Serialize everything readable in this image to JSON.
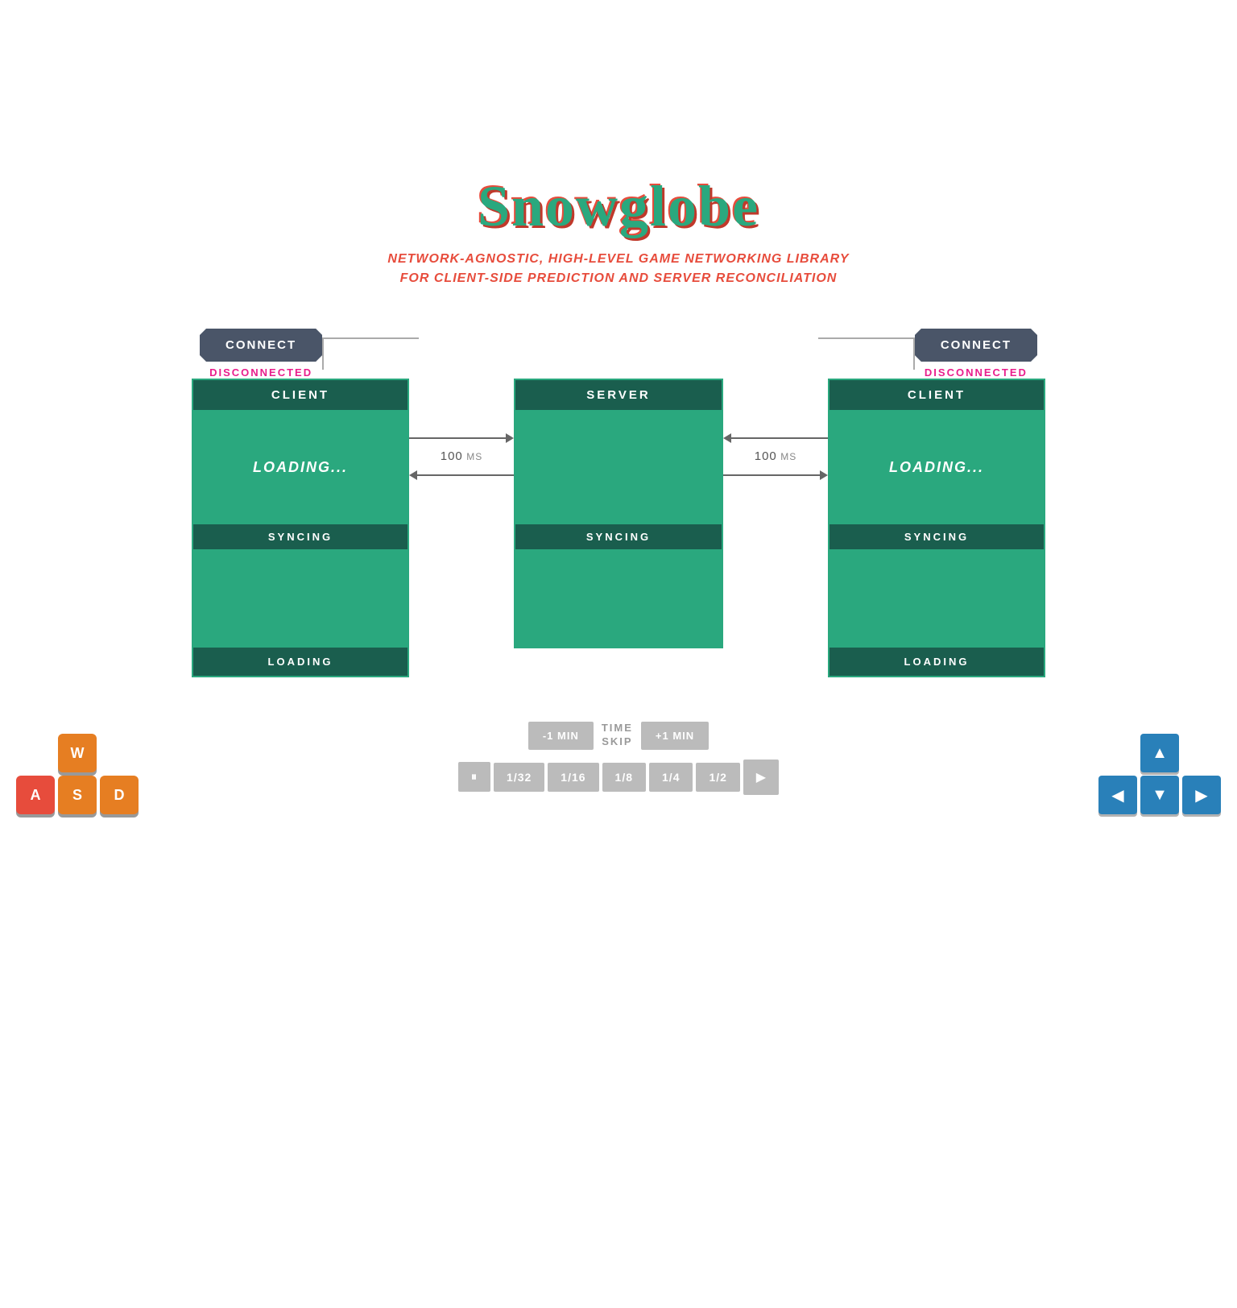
{
  "title": {
    "main": "Snowglobe",
    "subtitle_line1": "NETWORK-AGNOSTIC, HIGH-LEVEL GAME NETWORKING LIBRARY",
    "subtitle_line2": "FOR CLIENT-SIDE PREDICTION AND SERVER RECONCILIATION"
  },
  "left_connection": {
    "button_label": "CONNECT",
    "status": "DISCONNECTED"
  },
  "right_connection": {
    "button_label": "CONNECT",
    "status": "DISCONNECTED"
  },
  "left_client": {
    "header": "CLIENT",
    "loading": "LOADING...",
    "sync": "SYNCING",
    "footer": "LOADING"
  },
  "server": {
    "header": "SERVER",
    "sync": "SYNCING"
  },
  "right_client": {
    "header": "CLIENT",
    "loading": "LOADING...",
    "sync": "SYNCING",
    "footer": "LOADING"
  },
  "network_left": {
    "ms_value": "100",
    "ms_unit": "MS"
  },
  "network_right": {
    "ms_value": "100",
    "ms_unit": "MS"
  },
  "time_skip": {
    "label": "TIME\nSKIP",
    "minus_label": "-1 MIN",
    "plus_label": "+1 MIN"
  },
  "playback": {
    "pause_icon": "⏸",
    "speed_1": "1/32",
    "speed_2": "1/16",
    "speed_3": "1/8",
    "speed_4": "1/4",
    "speed_5": "1/2",
    "play_icon": "▶"
  },
  "wasd": {
    "w": "W",
    "a": "A",
    "s": "S",
    "d": "D"
  },
  "dir_keys": {
    "up": "▲",
    "left": "◀",
    "down": "▼",
    "right": "▶"
  },
  "colors": {
    "panel_bg": "#1a5e4e",
    "panel_accent": "#2aa87e",
    "connect_btn": "#4a5568",
    "disconnected": "#e91e8c",
    "key_orange": "#e67e22",
    "key_red": "#e74c3c",
    "dir_key_blue": "#2980b9"
  }
}
